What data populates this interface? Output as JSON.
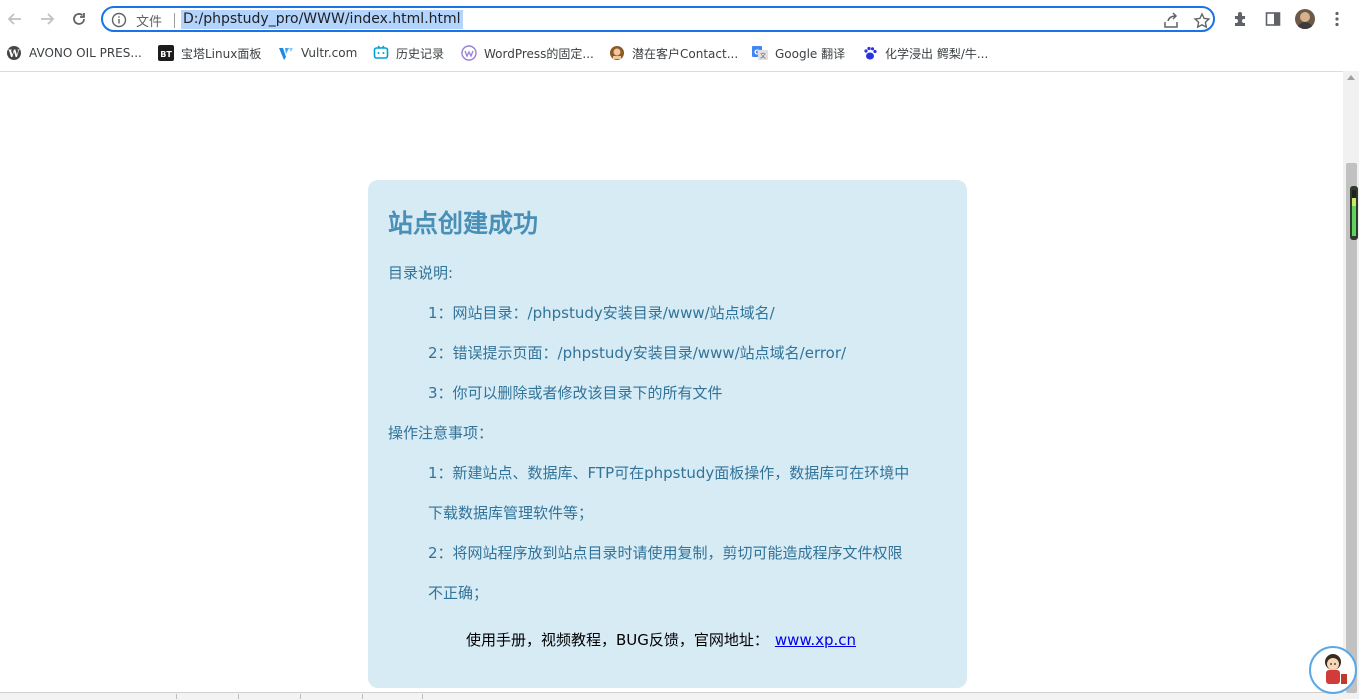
{
  "browser": {
    "scheme_label": "文件",
    "url": "D:/phpstudy_pro/WWW/index.html.html",
    "icons": [
      "back-icon",
      "forward-icon",
      "reload-icon",
      "info-icon",
      "share-icon",
      "star-icon",
      "extensions-icon",
      "sidepanel-icon",
      "profile-avatar",
      "menu-icon"
    ]
  },
  "bookmarks": [
    {
      "label": "AVONO OIL PRES...",
      "icon": "wordpress-icon"
    },
    {
      "label": "宝塔Linux面板",
      "icon": "bt-icon"
    },
    {
      "label": "Vultr.com",
      "icon": "vultr-icon"
    },
    {
      "label": "历史记录",
      "icon": "history-icon"
    },
    {
      "label": "WordPress的固定...",
      "icon": "wp-purple-icon"
    },
    {
      "label": "潜在客户Contact...",
      "icon": "contact-icon"
    },
    {
      "label": "Google 翻译",
      "icon": "google-translate-icon"
    },
    {
      "label": "化学浸出 鳄梨/牛...",
      "icon": "baidu-icon"
    }
  ],
  "page": {
    "title": "站点创建成功",
    "dir_heading": "目录说明:",
    "dir_items": [
      "1：网站目录：/phpstudy安装目录/www/站点域名/",
      "2：错误提示页面：/phpstudy安装目录/www/站点域名/error/",
      "3：你可以删除或者修改该目录下的所有文件"
    ],
    "ops_heading": "操作注意事项：",
    "ops_items": [
      "1：新建站点、数据库、FTP可在phpstudy面板操作，数据库可在环境中",
      "下载数据库管理软件等；",
      "2：将网站程序放到站点目录时请使用复制，剪切可能造成程序文件权限",
      "不正确；"
    ],
    "footer_text": "使用手册，视频教程，BUG反馈，官网地址：",
    "footer_link": "www.xp.cn"
  },
  "colors": {
    "card_bg": "#d7ebf5",
    "title": "#4a8fb5",
    "text": "#317399",
    "link": "#0000ee",
    "focus_ring": "#1a73e8"
  }
}
